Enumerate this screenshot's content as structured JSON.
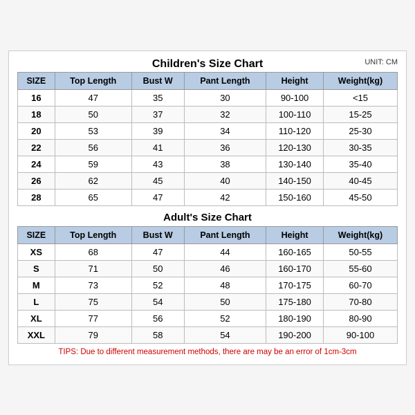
{
  "page": {
    "unit": "UNIT: CM",
    "children_title": "Children's Size Chart",
    "adult_title": "Adult's Size Chart",
    "columns": [
      "SIZE",
      "Top Length",
      "Bust W",
      "Pant Length",
      "Height",
      "Weight(kg)"
    ],
    "children_rows": [
      [
        "16",
        "47",
        "35",
        "30",
        "90-100",
        "<15"
      ],
      [
        "18",
        "50",
        "37",
        "32",
        "100-110",
        "15-25"
      ],
      [
        "20",
        "53",
        "39",
        "34",
        "110-120",
        "25-30"
      ],
      [
        "22",
        "56",
        "41",
        "36",
        "120-130",
        "30-35"
      ],
      [
        "24",
        "59",
        "43",
        "38",
        "130-140",
        "35-40"
      ],
      [
        "26",
        "62",
        "45",
        "40",
        "140-150",
        "40-45"
      ],
      [
        "28",
        "65",
        "47",
        "42",
        "150-160",
        "45-50"
      ]
    ],
    "adult_rows": [
      [
        "XS",
        "68",
        "47",
        "44",
        "160-165",
        "50-55"
      ],
      [
        "S",
        "71",
        "50",
        "46",
        "160-170",
        "55-60"
      ],
      [
        "M",
        "73",
        "52",
        "48",
        "170-175",
        "60-70"
      ],
      [
        "L",
        "75",
        "54",
        "50",
        "175-180",
        "70-80"
      ],
      [
        "XL",
        "77",
        "56",
        "52",
        "180-190",
        "80-90"
      ],
      [
        "XXL",
        "79",
        "58",
        "54",
        "190-200",
        "90-100"
      ]
    ],
    "tips": "TIPS: Due to different measurement methods, there are may be an error of 1cm-3cm"
  }
}
